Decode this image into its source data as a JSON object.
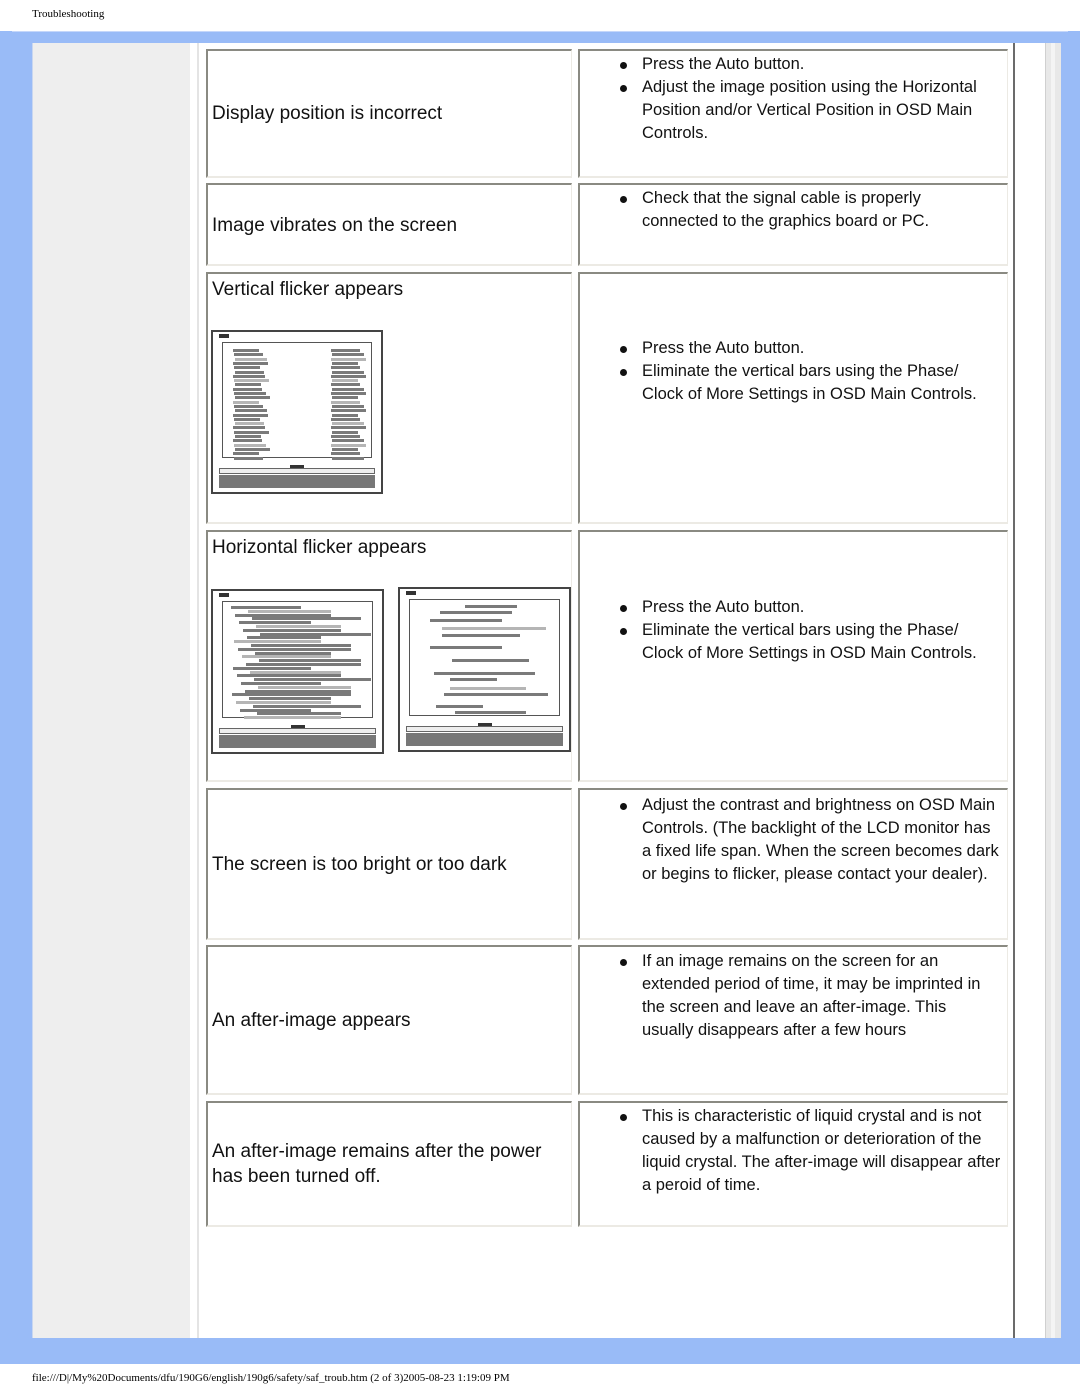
{
  "header": {
    "title": "Troubleshooting"
  },
  "rows": [
    {
      "problem": "Display position is incorrect",
      "solutions": [
        "Press the Auto button.",
        "Adjust the image position using the Horizontal Position and/or Vertical Position in OSD Main Controls."
      ]
    },
    {
      "problem": "Image vibrates on the screen",
      "solutions": [
        "Check that the signal cable is properly connected to the graphics board or PC."
      ]
    },
    {
      "problem": "Vertical flicker appears",
      "illustration": "monitor-vertical-flicker",
      "solutions": [
        "Press the Auto button.",
        "Eliminate the vertical bars using the Phase/ Clock of More Settings in OSD Main Controls."
      ]
    },
    {
      "problem": "Horizontal flicker appears",
      "illustrations": [
        "monitor-horizontal-flicker",
        "monitor-horizontal-lines"
      ],
      "solutions": [
        "Press the Auto button.",
        "Eliminate the vertical bars using the Phase/ Clock of More Settings in OSD Main Controls."
      ]
    },
    {
      "problem": "The screen is too bright or too dark",
      "solutions": [
        "Adjust the contrast and brightness on OSD Main Controls. (The backlight of the LCD monitor has a fixed life span. When the screen becomes dark or begins to flicker, please contact your dealer)."
      ]
    },
    {
      "problem": "An after-image appears",
      "solutions": [
        "If an image remains on the screen for an extended period of time, it may be imprinted in the screen and leave an after-image. This usually disappears after a few hours"
      ]
    },
    {
      "problem": "An after-image remains after the power has been turned off.",
      "solutions": [
        "This is characteristic of liquid crystal and is not caused by a malfunction or deterioration of the liquid crystal. The after-image will disappear after a peroid of time."
      ]
    }
  ],
  "footer": {
    "path": "file:///D|/My%20Documents/dfu/190G6/english/190g6/safety/saf_troub.htm (2 of 3)2005-08-23 1:19:09 PM"
  },
  "colors": {
    "frame": "#99bbf7",
    "nav": "#eeeeee",
    "content": "#ffffff"
  }
}
